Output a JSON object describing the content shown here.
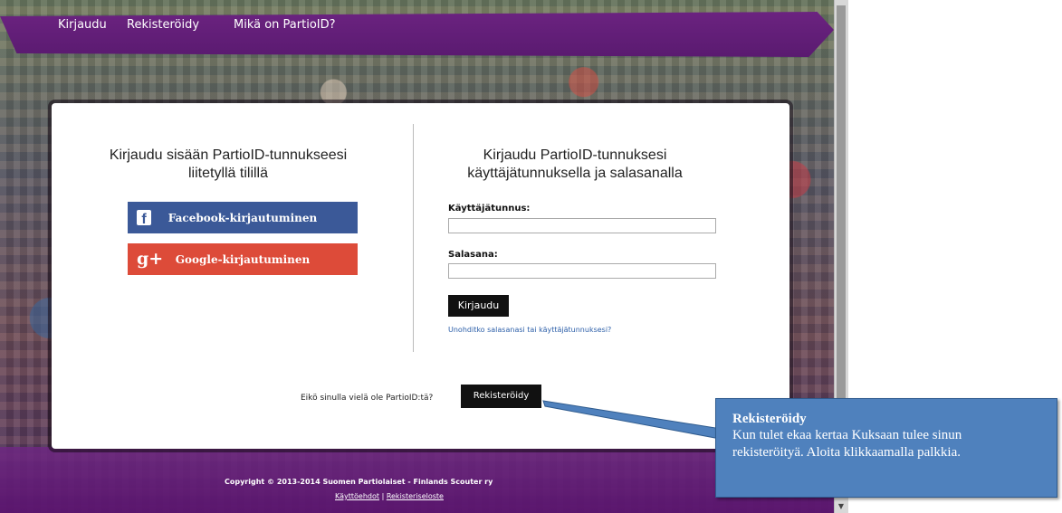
{
  "nav": {
    "items": [
      "Kirjaudu",
      "Rekisteröidy",
      "Mikä on PartioID?"
    ]
  },
  "left": {
    "heading": "Kirjaudu sisään PartioID-tunnukseesi liitetyllä tilillä",
    "facebook_label": "Facebook-kirjautuminen",
    "facebook_icon": "f",
    "google_label": "Google-kirjautuminen",
    "google_icon": "g+"
  },
  "right": {
    "heading": "Kirjaudu PartioID-tunnuksesi käyttäjätunnuksella ja salasanalla",
    "username_label": "Käyttäjätunnus:",
    "username_value": "",
    "password_label": "Salasana:",
    "password_value": "",
    "login_button": "Kirjaudu",
    "forgot_link": "Unohditko salasanasi tai käyttäjätunnuksesi?"
  },
  "register": {
    "prompt": "Eikö sinulla vielä ole PartioID:tä?",
    "button": "Rekisteröidy"
  },
  "footer": {
    "copyright": "Copyright © 2013-2014 Suomen Partiolaiset - Finlands Scouter ry",
    "link_terms": "Käyttöehdot",
    "separator": "|",
    "link_privacy": "Rekisteriseloste"
  },
  "callout": {
    "title": "Rekisteröidy",
    "text": "Kun tulet ekaa kertaa Kuksaan tulee sinun rekisteröityä. Aloita klikkaamalla palkkia."
  },
  "colors": {
    "facebook": "#3b5998",
    "google": "#dd4b39",
    "topbar": "#6b2380",
    "callout": "#4f81bd"
  }
}
